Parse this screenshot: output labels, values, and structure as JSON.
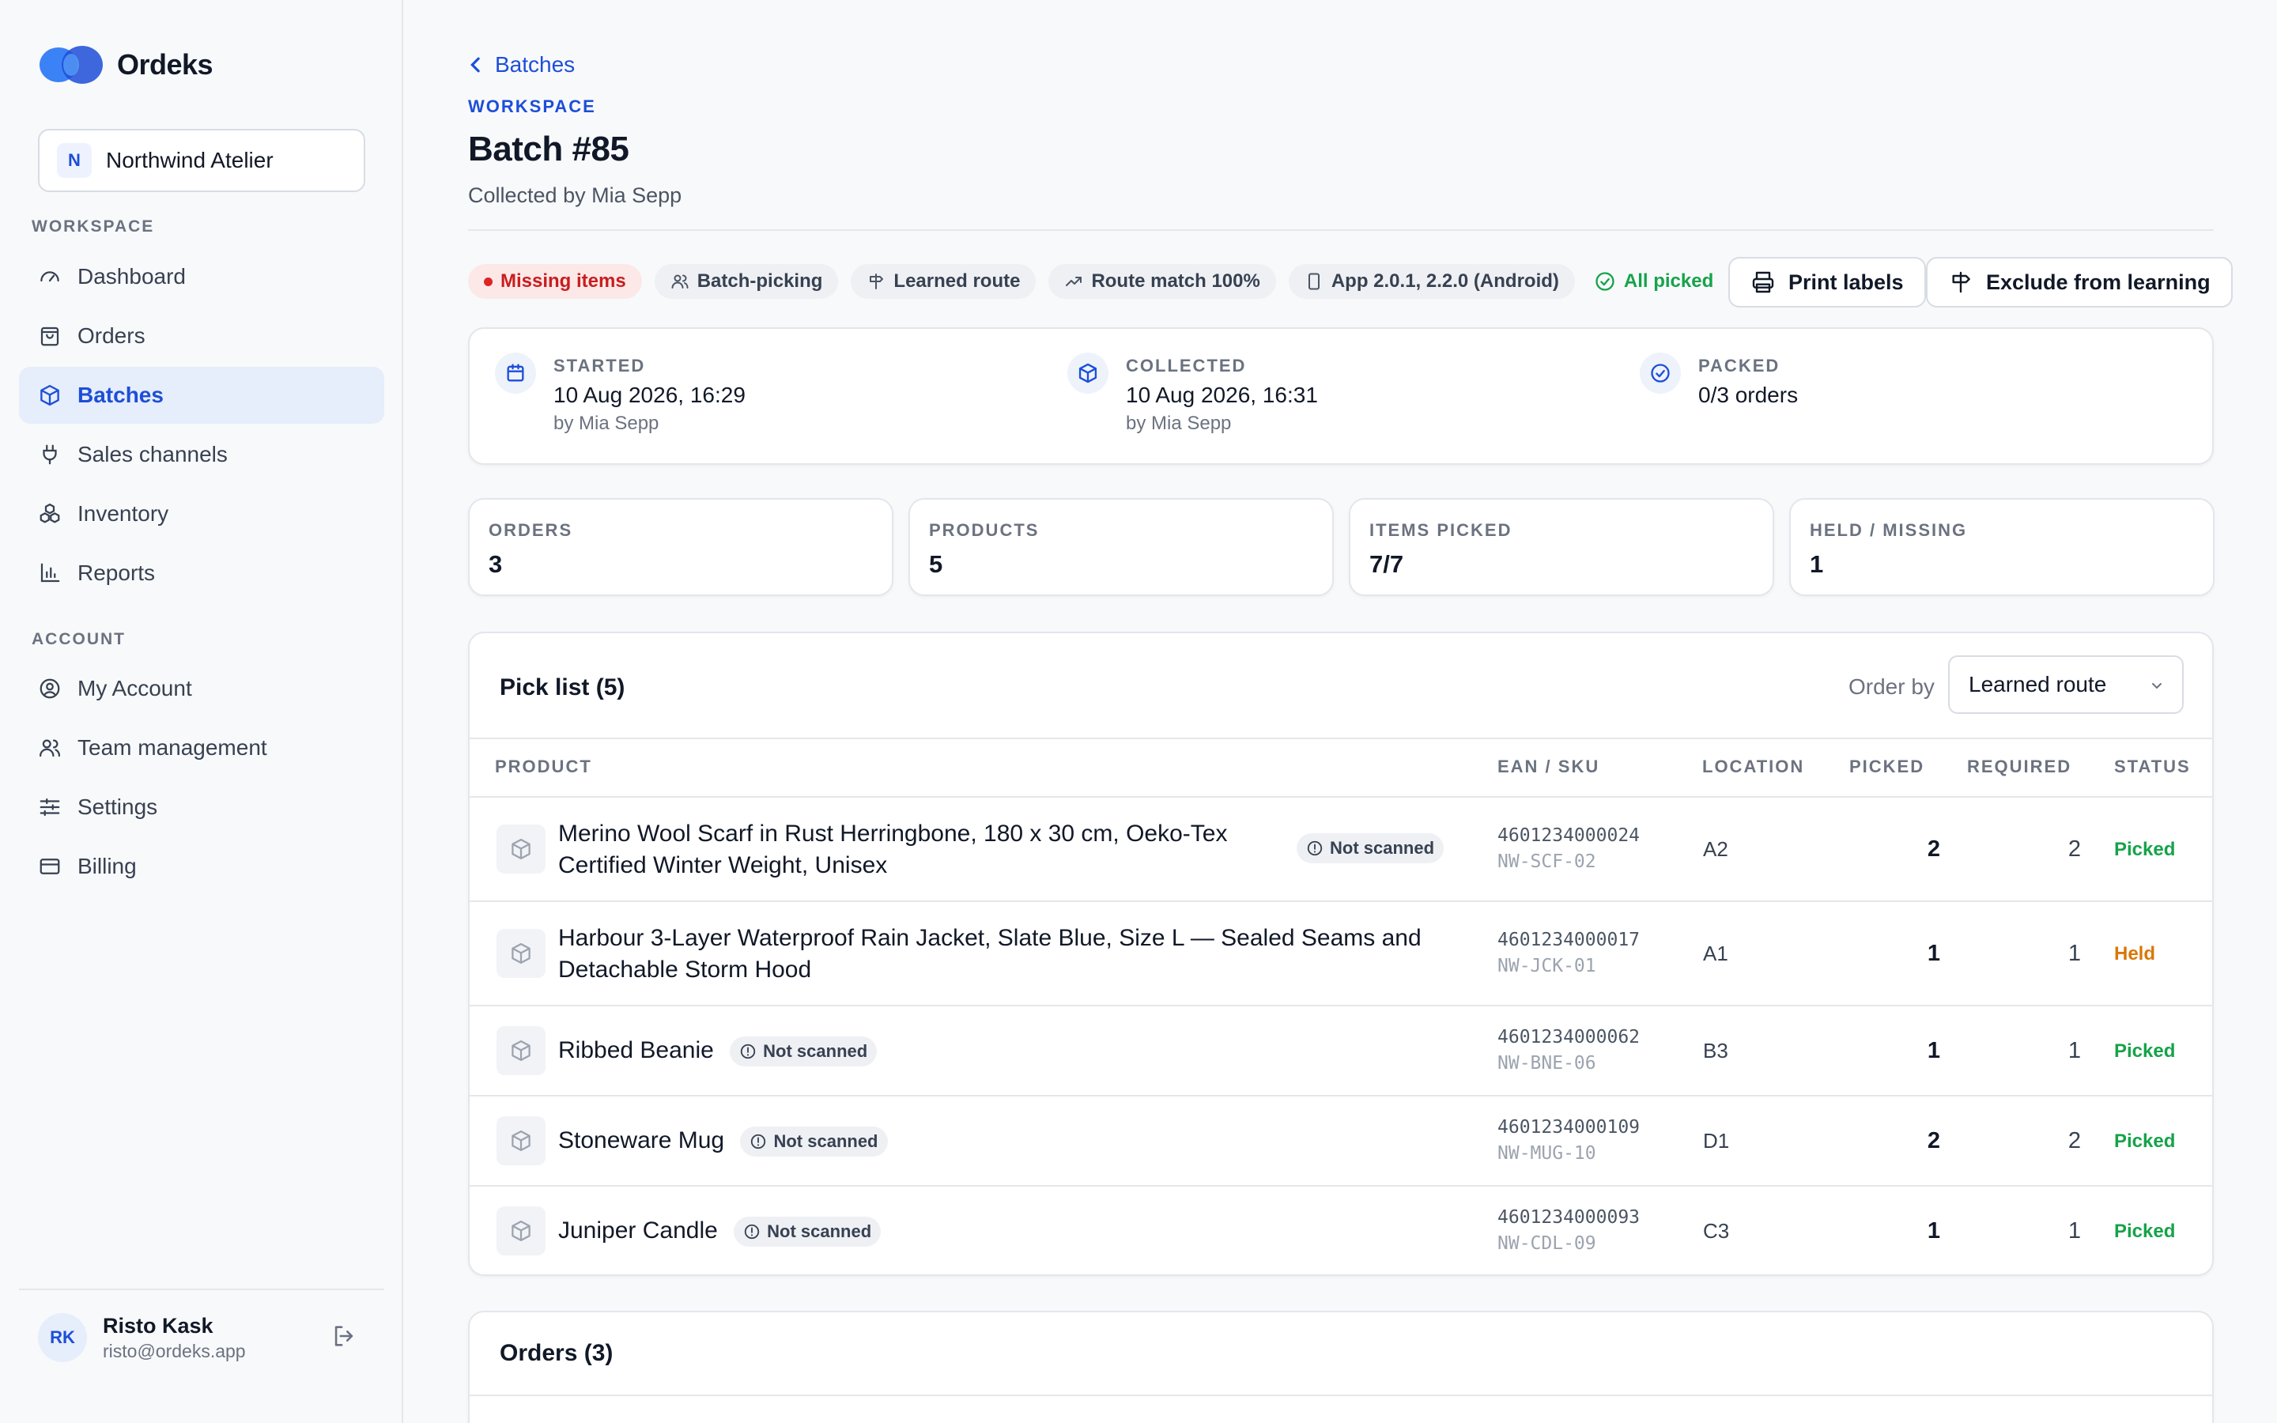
{
  "app": {
    "name": "Ordeks",
    "brand_color": "#1d4ed8"
  },
  "sidebar": {
    "workspace": {
      "initial": "N",
      "name": "Northwind Atelier"
    },
    "workspace_section": "WORKSPACE",
    "workspace_items": [
      {
        "label": "Dashboard",
        "icon": "gauge-icon"
      },
      {
        "label": "Orders",
        "icon": "shopping-bag-icon"
      },
      {
        "label": "Batches",
        "icon": "box-icon",
        "active": true
      },
      {
        "label": "Sales channels",
        "icon": "plug-icon"
      },
      {
        "label": "Inventory",
        "icon": "boxes-icon"
      },
      {
        "label": "Reports",
        "icon": "bar-chart-icon"
      }
    ],
    "account_section": "ACCOUNT",
    "account_items": [
      {
        "label": "My Account",
        "icon": "user-circle-icon"
      },
      {
        "label": "Team management",
        "icon": "users-icon"
      },
      {
        "label": "Settings",
        "icon": "sliders-icon"
      },
      {
        "label": "Billing",
        "icon": "credit-card-icon"
      }
    ],
    "user": {
      "initials": "RK",
      "name": "Risto Kask",
      "email": "risto@ordeks.app"
    }
  },
  "header": {
    "back_label": "Batches",
    "eyebrow": "WORKSPACE",
    "title": "Batch #85",
    "subtitle": "Collected by Mia Sepp"
  },
  "tags": {
    "missing": "Missing items",
    "batch_picking": "Batch-picking",
    "learned_route": "Learned route",
    "route_match": "Route match 100%",
    "app_version": "App 2.0.1, 2.2.0 (Android)",
    "all_picked": "All picked"
  },
  "actions": {
    "print_labels": "Print labels",
    "exclude": "Exclude from learning"
  },
  "timeline": [
    {
      "label": "STARTED",
      "value": "10 Aug 2026, 16:29",
      "by": "by Mia Sepp"
    },
    {
      "label": "COLLECTED",
      "value": "10 Aug 2026, 16:31",
      "by": "by Mia Sepp"
    },
    {
      "label": "PACKED",
      "value": "0/3 orders",
      "by": ""
    }
  ],
  "stats": [
    {
      "label": "ORDERS",
      "value": "3"
    },
    {
      "label": "PRODUCTS",
      "value": "5"
    },
    {
      "label": "ITEMS PICKED",
      "value": "7/7"
    },
    {
      "label": "HELD / MISSING",
      "value": "1"
    }
  ],
  "picklist": {
    "title": "Pick list (5)",
    "order_by_label": "Order by",
    "order_by_value": "Learned route",
    "columns": [
      "PRODUCT",
      "EAN / SKU",
      "LOCATION",
      "PICKED",
      "REQUIRED",
      "STATUS"
    ],
    "not_scanned_label": "Not scanned",
    "rows": [
      {
        "name_line1": "Merino Wool Scarf in Rust Herringbone, 180 x 30 cm, Oeko-Tex",
        "name_line2": "Certified Winter Weight, Unisex",
        "not_scanned": true,
        "ean": "4601234000024",
        "sku": "NW-SCF-02",
        "location": "A2",
        "picked": "2",
        "required": "2",
        "status": "Picked"
      },
      {
        "name_line1": "Harbour 3-Layer Waterproof Rain Jacket, Slate Blue, Size L — Sealed Seams and",
        "name_line2": "Detachable Storm Hood",
        "not_scanned": false,
        "ean": "4601234000017",
        "sku": "NW-JCK-01",
        "location": "A1",
        "picked": "1",
        "required": "1",
        "status": "Held"
      },
      {
        "name_line1": "Ribbed Beanie",
        "name_line2": "",
        "not_scanned": true,
        "ean": "4601234000062",
        "sku": "NW-BNE-06",
        "location": "B3",
        "picked": "1",
        "required": "1",
        "status": "Picked"
      },
      {
        "name_line1": "Stoneware Mug",
        "name_line2": "",
        "not_scanned": true,
        "ean": "4601234000109",
        "sku": "NW-MUG-10",
        "location": "D1",
        "picked": "2",
        "required": "2",
        "status": "Picked"
      },
      {
        "name_line1": "Juniper Candle",
        "name_line2": "",
        "not_scanned": true,
        "ean": "4601234000093",
        "sku": "NW-CDL-09",
        "location": "C3",
        "picked": "1",
        "required": "1",
        "status": "Picked"
      }
    ]
  },
  "orders": {
    "title": "Orders (3)"
  },
  "colors": {
    "picked": "#16a34a",
    "held": "#d97706",
    "missing": "#c81e1e"
  }
}
